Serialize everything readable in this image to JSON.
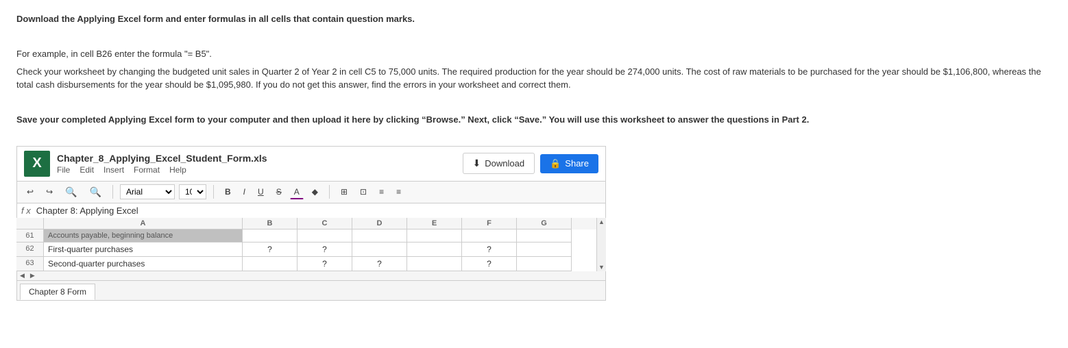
{
  "instructions": {
    "line1": "Download the Applying Excel form and enter formulas in all cells that contain question marks.",
    "line2": "For example, in cell B26 enter the formula \"= B5\".",
    "line3": "Check your worksheet by changing the budgeted unit sales in Quarter 2 of Year 2 in cell C5 to 75,000 units. The required production for the year should be 274,000 units. The cost of raw materials to be purchased for the year should be $1,106,800, whereas the total cash disbursements for the year should be $1,095,980. If you do not get this answer, find the errors in your worksheet and correct them.",
    "line4": "Save your completed Applying Excel form to your computer and then upload it here by clicking “Browse.” Next, click “Save.” You will use this worksheet to answer the questions in Part 2."
  },
  "spreadsheet": {
    "filename": "Chapter_8_Applying_Excel_Student_Form.xls",
    "excel_icon_label": "X",
    "menu": {
      "file": "File",
      "edit": "Edit",
      "insert": "Insert",
      "format": "Format",
      "help": "Help"
    },
    "download_button": "Download",
    "share_button": "Share",
    "toolbar": {
      "undo": "↩",
      "redo": "↪",
      "zoom_in": "🔍",
      "zoom_out": "🔍",
      "font": "Arial",
      "size": "10",
      "bold": "B",
      "italic": "I",
      "underline": "U",
      "strikethrough": "S",
      "font_color": "A"
    },
    "formula_bar": {
      "label": "f x",
      "value": "Chapter 8: Applying Excel"
    },
    "columns": [
      "A",
      "B",
      "C",
      "D",
      "E",
      "F",
      "G"
    ],
    "rows": [
      {
        "num": "61",
        "cells": [
          "Accounts payable, beginning balance",
          "",
          "",
          "",
          "",
          "",
          ""
        ]
      },
      {
        "num": "62",
        "cells": [
          "First-quarter purchases",
          "?",
          "?",
          "",
          "",
          "?",
          ""
        ]
      },
      {
        "num": "63",
        "cells": [
          "Second-quarter purchases",
          "",
          "?",
          "?",
          "",
          "?",
          ""
        ]
      }
    ],
    "sheet_tab": "Chapter 8 Form"
  }
}
